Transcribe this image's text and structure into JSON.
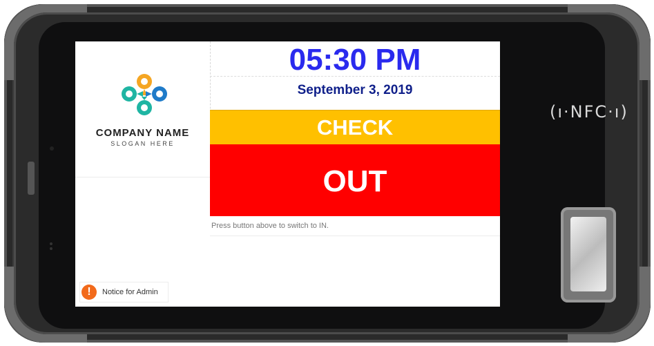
{
  "device": {
    "nfc_label": "(ı·NFC·ı)"
  },
  "branding": {
    "company_name": "COMPANY NAME",
    "slogan": "SLOGAN HERE",
    "logo_colors": [
      "#f5a623",
      "#1fb5a3",
      "#1f7bc9"
    ]
  },
  "clock": {
    "time": "05:30 PM",
    "date": "September 3, 2019"
  },
  "punch": {
    "check_label": "CHECK",
    "mode_label": "OUT",
    "hint": "Press button above to switch to IN."
  },
  "notice": {
    "icon": "exclamation-icon",
    "label": "Notice for Admin"
  },
  "colors": {
    "time": "#2a2aee",
    "date": "#0f1f8a",
    "check_bg": "#ffc000",
    "out_bg": "#ff0000",
    "notice_icon": "#f26a1b"
  }
}
